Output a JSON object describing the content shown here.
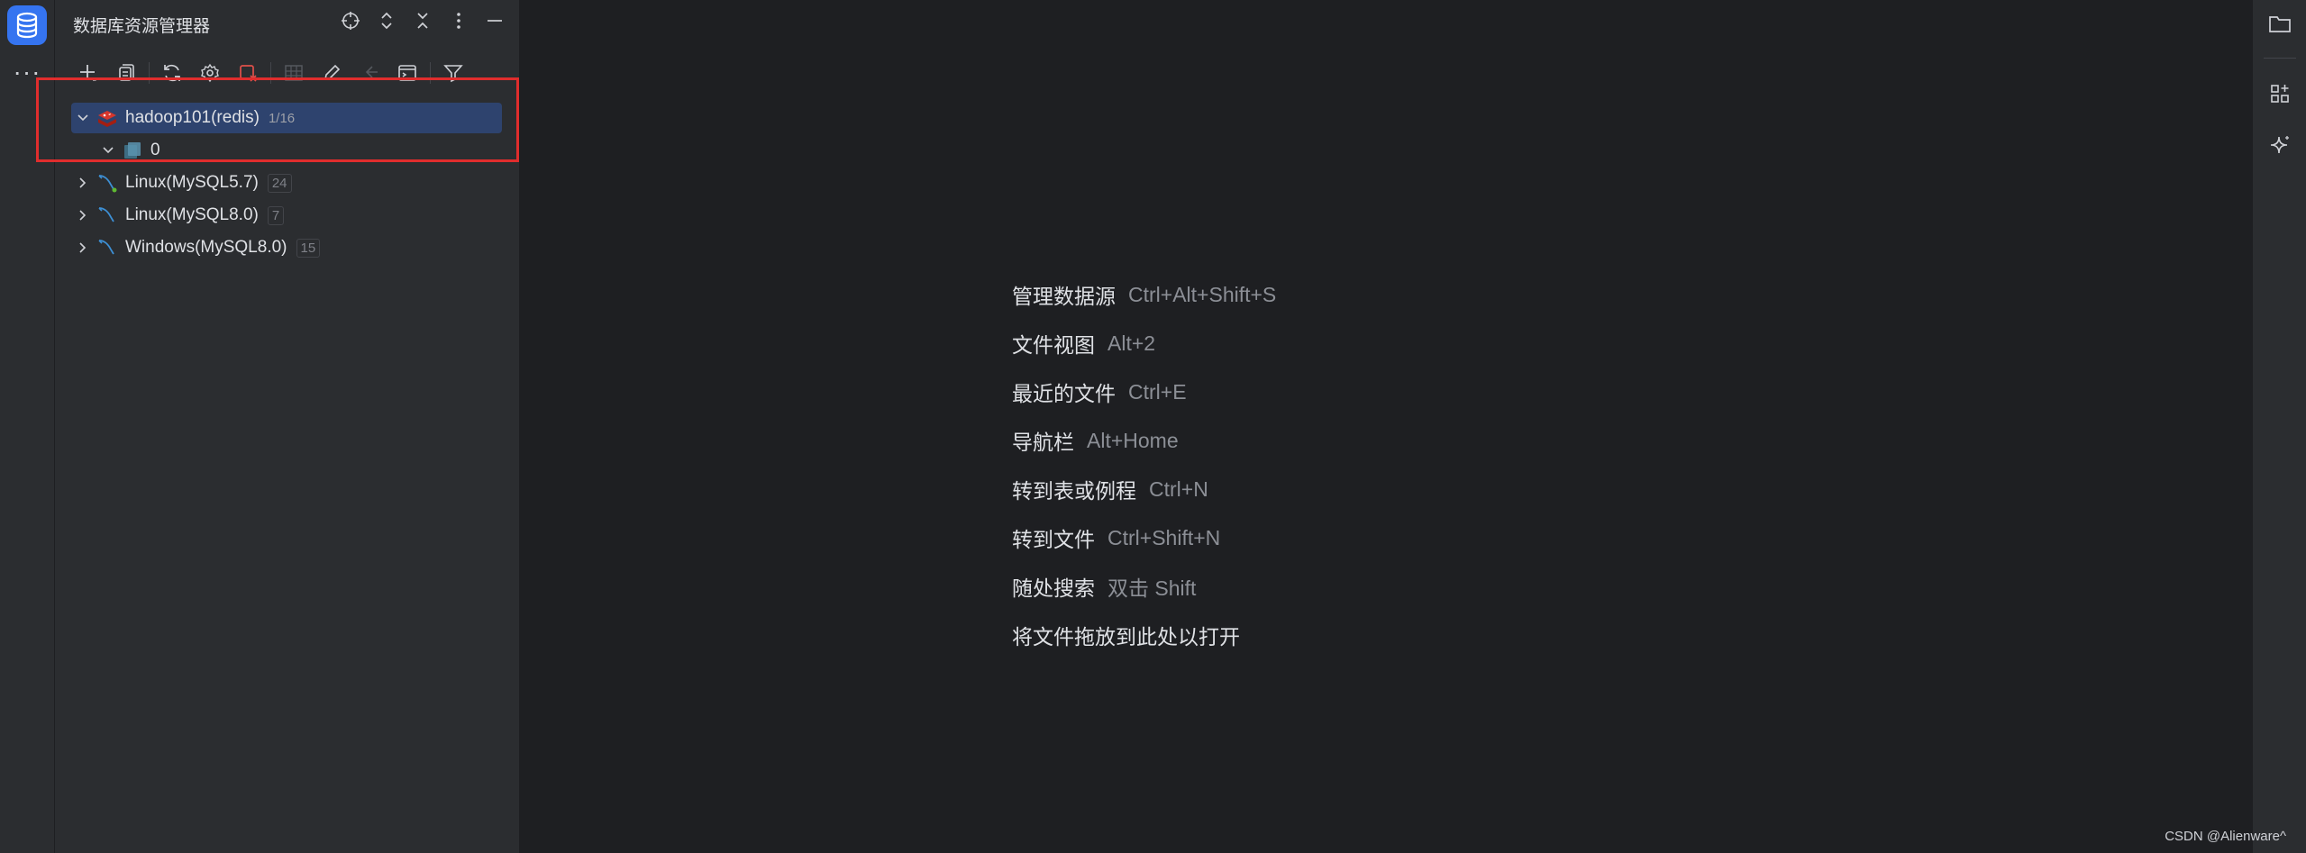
{
  "panel": {
    "title": "数据库资源管理器"
  },
  "tree": {
    "items": [
      {
        "label": "hadoop101(redis)",
        "badge": "1/16",
        "icon": "redis-icon",
        "expanded": true
      },
      {
        "label": "0",
        "icon": "database-schema-icon",
        "expanded": true
      },
      {
        "label": "Linux(MySQL5.7)",
        "badge": "24",
        "icon": "mysql-dolphin-icon",
        "expanded": false
      },
      {
        "label": "Linux(MySQL8.0)",
        "badge": "7",
        "icon": "mysql-dolphin-icon",
        "expanded": false
      },
      {
        "label": "Windows(MySQL8.0)",
        "badge": "15",
        "icon": "mysql-dolphin-icon",
        "expanded": false
      }
    ]
  },
  "hints": [
    {
      "label": "管理数据源",
      "key": "Ctrl+Alt+Shift+S"
    },
    {
      "label": "文件视图",
      "key": "Alt+2"
    },
    {
      "label": "最近的文件",
      "key": "Ctrl+E"
    },
    {
      "label": "导航栏",
      "key": "Alt+Home"
    },
    {
      "label": "转到表或例程",
      "key": "Ctrl+N"
    },
    {
      "label": "转到文件",
      "key": "Ctrl+Shift+N"
    },
    {
      "label": "随处搜索",
      "key": "双击 Shift"
    },
    {
      "label": "将文件拖放到此处以打开",
      "key": ""
    }
  ],
  "watermark": "CSDN @Alienware^",
  "colors": {
    "accent": "#3574f0",
    "selection": "#2e436e",
    "highlight_box": "#e02d2d",
    "redis": "#d6362c",
    "mysql": "#3d8fd4"
  }
}
